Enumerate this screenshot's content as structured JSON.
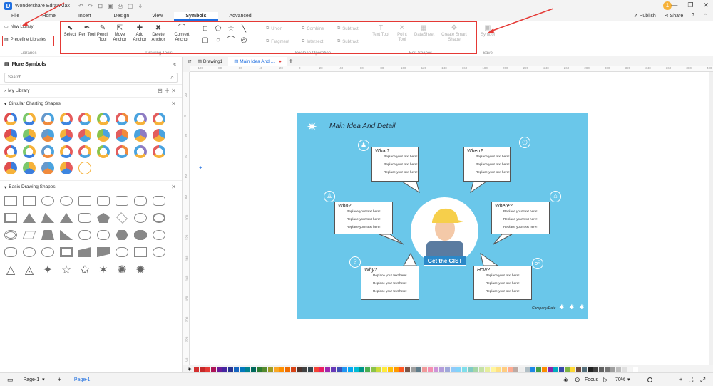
{
  "app": {
    "title": "Wondershare EdrawMax",
    "logo": "D"
  },
  "qat": [
    "↶",
    "↷",
    "⊡",
    "▣",
    "⎙",
    "▢",
    "⇩"
  ],
  "user_badge": "1",
  "menu": {
    "tabs": [
      "File",
      "Home",
      "Insert",
      "Design",
      "View",
      "Symbols",
      "Advanced"
    ],
    "active": "Symbols",
    "publish": "Publish",
    "share": "Share",
    "help": "?"
  },
  "ribbon": {
    "libraries": {
      "new_library": "New Library",
      "predefine": "Predefine Libraries",
      "label": "Libraries"
    },
    "drawing_tools": {
      "label": "Drawing Tools",
      "buttons": [
        {
          "name": "select",
          "label": "Select",
          "icon": "⬉"
        },
        {
          "name": "pen-tool",
          "label": "Pen Tool",
          "icon": "✒"
        },
        {
          "name": "pencil-tool",
          "label": "Pencil Tool",
          "icon": "✎"
        },
        {
          "name": "move-anchor",
          "label": "Move Anchor",
          "icon": "⇱"
        },
        {
          "name": "add-anchor",
          "label": "Add Anchor",
          "icon": "✚"
        },
        {
          "name": "delete-anchor",
          "label": "Delete Anchor",
          "icon": "✖"
        },
        {
          "name": "convert-anchor",
          "label": "Convert Anchor",
          "icon": "⌒"
        }
      ],
      "shapes": [
        "□",
        "⬠",
        "☆",
        "╲",
        "▢",
        "○",
        "⌒",
        "◎"
      ]
    },
    "boolean": {
      "label": "Boolean Operation",
      "items": [
        "Union",
        "Combine",
        "Subtract",
        "Fragment",
        "Intersect",
        "Subtract"
      ]
    },
    "edit_shapes": {
      "label": "Edit Shapes",
      "items": [
        "Text Tool",
        "Point Tool",
        "DataSheet",
        "Create Smart Shape"
      ]
    },
    "save": {
      "label": "Save",
      "item": "Symbol"
    }
  },
  "left_panel": {
    "title": "More Symbols",
    "search_placeholder": "Search",
    "my_library": "My Library",
    "section1": "Circular Charting Shapes",
    "section2": "Basic Drawing Shapes"
  },
  "doc_tabs": [
    "Drawing1",
    "Main Idea And ..."
  ],
  "ruler_top": [
    "-100",
    "-80",
    "-60",
    "-40",
    "-20",
    "0",
    "20",
    "40",
    "60",
    "80",
    "100",
    "120",
    "140",
    "160",
    "180",
    "200",
    "220",
    "240",
    "260",
    "280",
    "300",
    "320",
    "340",
    "360",
    "380",
    "400"
  ],
  "ruler_left": [
    "20",
    "0",
    "20",
    "40",
    "60",
    "80",
    "100",
    "120",
    "140",
    "160",
    "180",
    "200",
    "220",
    "240"
  ],
  "diagram": {
    "title": "Main Idea And Detail",
    "center_label": "Get the GIST",
    "placeholder": "Replace your text here!",
    "company": "Company/Date",
    "footer_stars": "✱ ✱ ✱",
    "boxes": [
      {
        "title": "What?",
        "icon": "♟"
      },
      {
        "title": "When?",
        "icon": "◷"
      },
      {
        "title": "Who?",
        "icon": "♙"
      },
      {
        "title": "Where?",
        "icon": "⌂"
      },
      {
        "title": "Why?",
        "icon": "?"
      },
      {
        "title": "How?",
        "icon": "☍"
      }
    ]
  },
  "status": {
    "page_tab": "Page-1",
    "page_active": "Page-1",
    "focus": "Focus",
    "zoom": "70%"
  },
  "colors": [
    "#d32f2f",
    "#c62828",
    "#e53935",
    "#ad1457",
    "#6a1b9a",
    "#4527a0",
    "#283593",
    "#1565c0",
    "#0277bd",
    "#00838f",
    "#00695c",
    "#2e7d32",
    "#558b2f",
    "#9e9d24",
    "#f9a825",
    "#ff8f00",
    "#ef6c00",
    "#d84315",
    "#4e342e",
    "#424242",
    "#37474f",
    "#f44336",
    "#e91e63",
    "#9c27b0",
    "#673ab7",
    "#3f51b5",
    "#2196f3",
    "#03a9f4",
    "#00bcd4",
    "#009688",
    "#4caf50",
    "#8bc34a",
    "#cddc39",
    "#ffeb3b",
    "#ffc107",
    "#ff9800",
    "#ff5722",
    "#795548",
    "#9e9e9e",
    "#607d8b",
    "#ef9a9a",
    "#f48fb1",
    "#ce93d8",
    "#b39ddb",
    "#9fa8da",
    "#90caf9",
    "#81d4fa",
    "#80deea",
    "#80cbc4",
    "#a5d6a7",
    "#c5e1a5",
    "#e6ee9c",
    "#fff59d",
    "#ffe082",
    "#ffcc80",
    "#ffab91",
    "#bcaaa4",
    "#eeeeee",
    "#b0bec5",
    "#1e88e5",
    "#43a047",
    "#fb8c00",
    "#8e24aa",
    "#00acc1",
    "#3949ab",
    "#7cb342",
    "#fdd835",
    "#6d4c41",
    "#546e7a",
    "#212121",
    "#424242",
    "#616161",
    "#757575",
    "#9e9e9e",
    "#bdbdbd",
    "#e0e0e0",
    "#f5f5f5",
    "#ffffff"
  ]
}
